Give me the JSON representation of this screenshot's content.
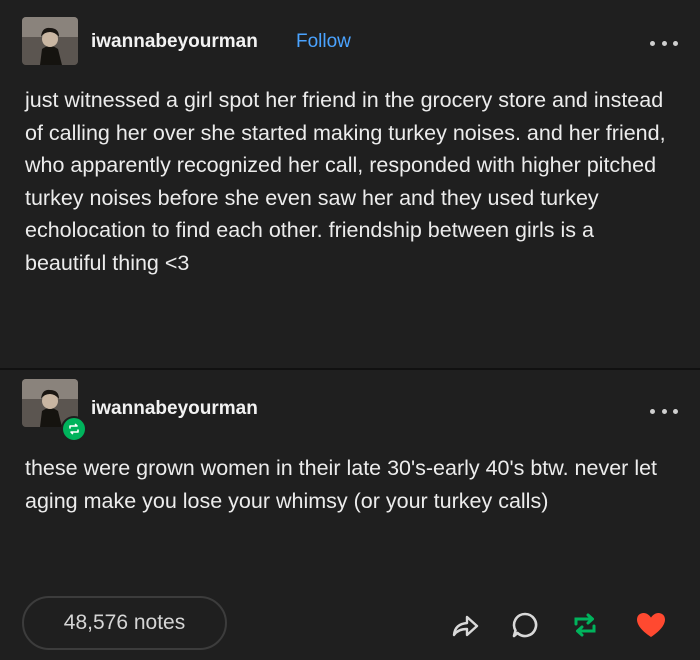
{
  "original_post": {
    "username": "iwannabeyourman",
    "follow_label": "Follow",
    "avatar_icon": "profile-photo-icon",
    "more_icon": "more-options-icon",
    "paragraphs": [
      "just witnessed a girl spot her friend in the grocery store and instead of calling her over she started making turkey noises. and her friend, who apparently recognized her call, responded with higher pitched turkey noises before she even saw her and they used turkey echolocation to find each other. friendship between girls is a beautiful thing <3"
    ]
  },
  "reblog_post": {
    "username": "iwannabeyourman",
    "avatar_icon": "profile-photo-icon",
    "badge_icon": "reblog-badge-icon",
    "more_icon": "more-options-icon",
    "paragraphs": [
      "these were grown women in their late 30's-early 40's btw. never let aging make you lose your whimsy (or your turkey calls)"
    ]
  },
  "footer": {
    "notes_label": "48,576 notes",
    "actions": [
      {
        "name": "share",
        "icon": "share-icon"
      },
      {
        "name": "reply",
        "icon": "reply-icon"
      },
      {
        "name": "reblog",
        "icon": "reblog-icon"
      },
      {
        "name": "like",
        "icon": "heart-icon"
      }
    ]
  },
  "colors": {
    "background": "#1f1f1f",
    "text": "#ececec",
    "link_blue": "#4aa3ff",
    "reblog_green": "#00b35c",
    "like_red": "#ff4930"
  }
}
